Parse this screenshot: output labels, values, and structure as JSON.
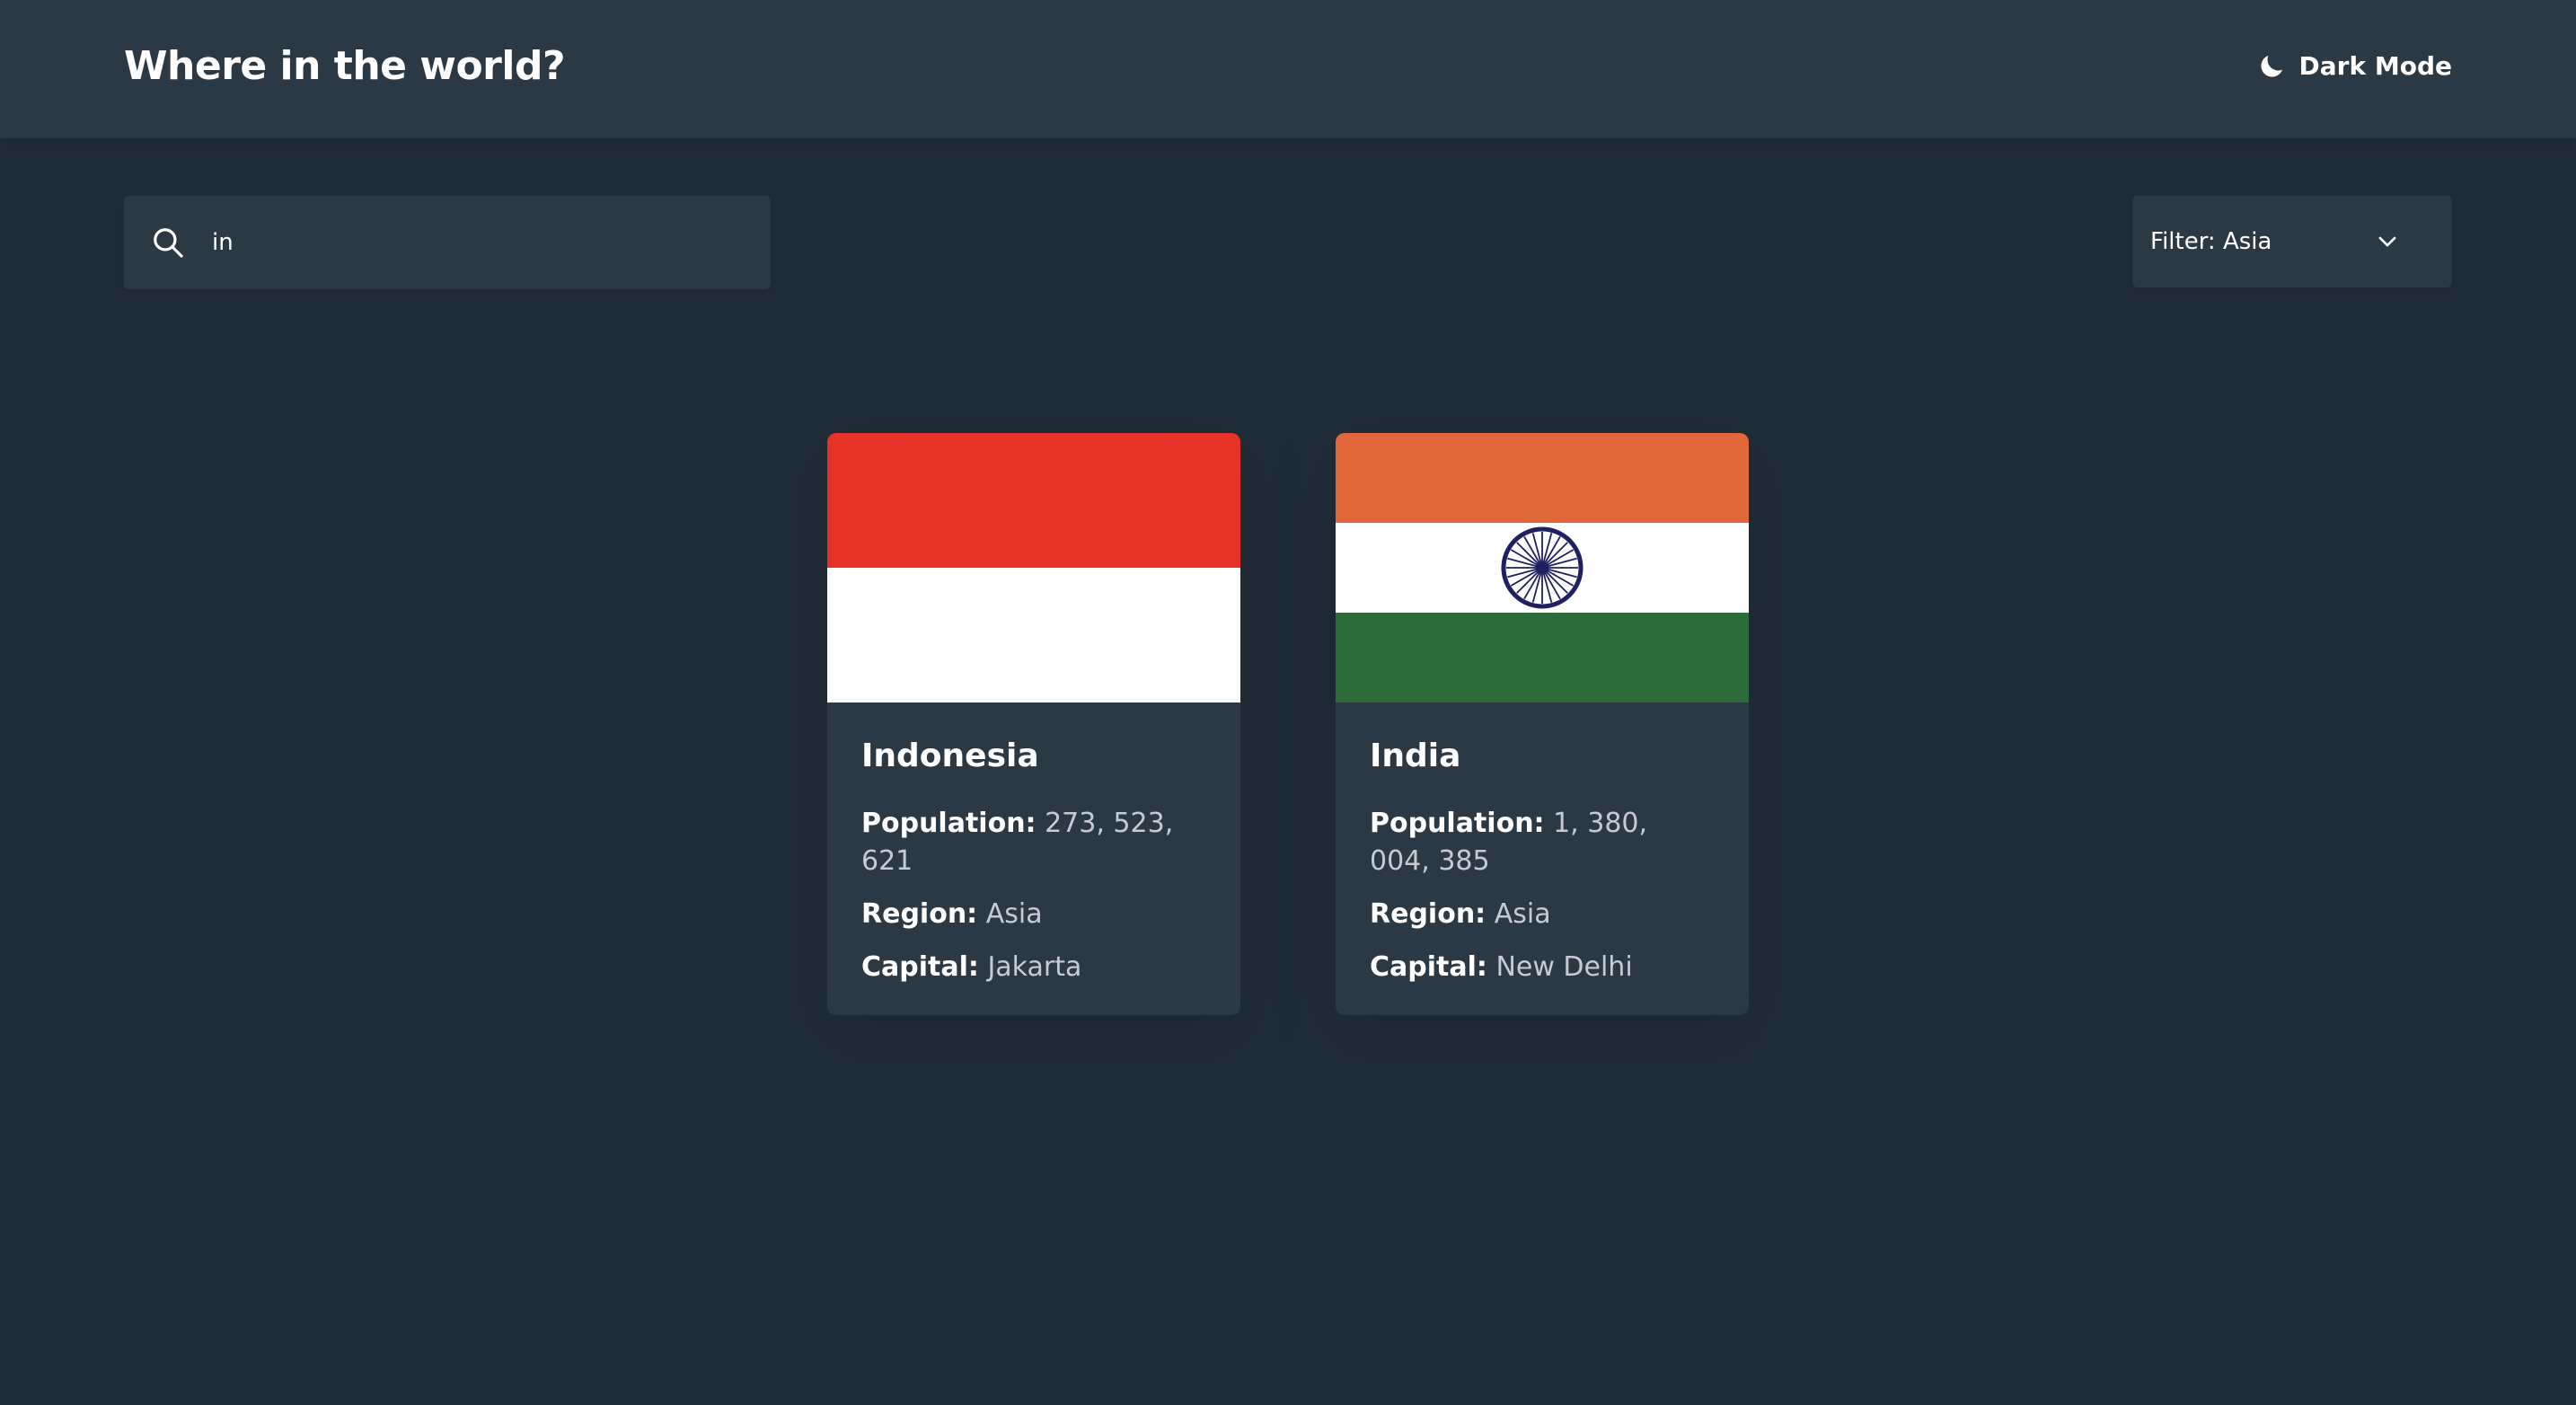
{
  "header": {
    "title": "Where in the world?",
    "theme_toggle": {
      "label": "Dark Mode",
      "icon": "moon-icon"
    }
  },
  "search": {
    "value": "in",
    "icon": "search-icon"
  },
  "filter": {
    "label": "Filter: Asia",
    "icon": "chevron-down-icon"
  },
  "stat_labels": {
    "population": "Population:",
    "region": "Region:",
    "capital": "Capital:"
  },
  "countries": [
    {
      "name": "Indonesia",
      "population": "273, 523, 621",
      "region": "Asia",
      "capital": "Jakarta",
      "flag": {
        "colors": [
          "#e63329",
          "#ffffff"
        ]
      }
    },
    {
      "name": "India",
      "population": "1, 380, 004, 385",
      "region": "Asia",
      "capital": "New Delhi",
      "flag": {
        "colors": [
          "#e0673a",
          "#ffffff",
          "#2e6b3b"
        ],
        "chakra": "#1e2060"
      }
    }
  ],
  "colors": {
    "background": "#202c37",
    "element": "#2b3945",
    "text": "#ffffff",
    "value_text": "#c7cbd0"
  }
}
